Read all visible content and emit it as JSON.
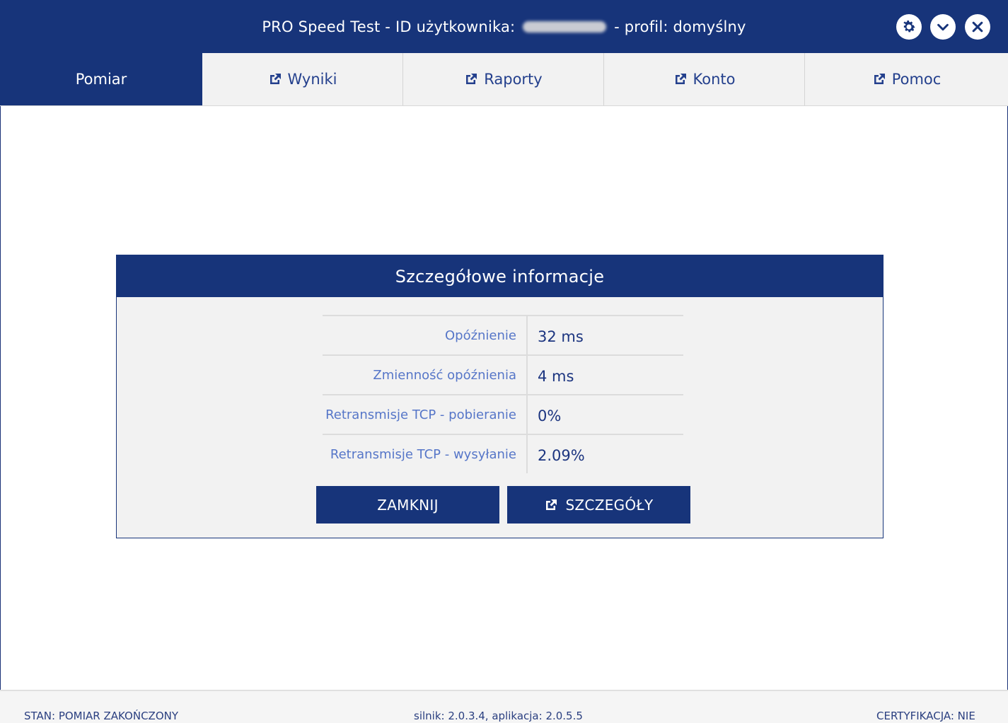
{
  "titlebar": {
    "title_prefix": "PRO Speed Test - ID użytkownika:",
    "title_suffix": "- profil: domyślny",
    "buttons": [
      "gear-icon",
      "chevron-down-icon",
      "close-icon"
    ]
  },
  "tabs": [
    {
      "label": "Pomiar",
      "active": true,
      "external": false
    },
    {
      "label": "Wyniki",
      "active": false,
      "external": true
    },
    {
      "label": "Raporty",
      "active": false,
      "external": true
    },
    {
      "label": "Konto",
      "active": false,
      "external": true
    },
    {
      "label": "Pomoc",
      "active": false,
      "external": true
    }
  ],
  "dialog": {
    "title": "Szczegółowe informacje",
    "rows": [
      {
        "label": "Opóźnienie",
        "value": "32 ms"
      },
      {
        "label": "Zmienność opóźnienia",
        "value": "4 ms"
      },
      {
        "label": "Retransmisje TCP - pobieranie",
        "value": "0%"
      },
      {
        "label": "Retransmisje TCP - wysyłanie",
        "value": "2.09%"
      }
    ],
    "close_label": "ZAMKNIJ",
    "details_label": "SZCZEGÓŁY"
  },
  "status": {
    "state": "STAN: POMIAR ZAKOŃCZONY",
    "version": "silnik: 2.0.3.4, aplikacja: 2.0.5.5",
    "certification": "CERTYFIKACJA: NIE"
  },
  "colors": {
    "primary": "#17347a",
    "label": "#5676c8",
    "tab_bg": "#f2f2f2"
  }
}
